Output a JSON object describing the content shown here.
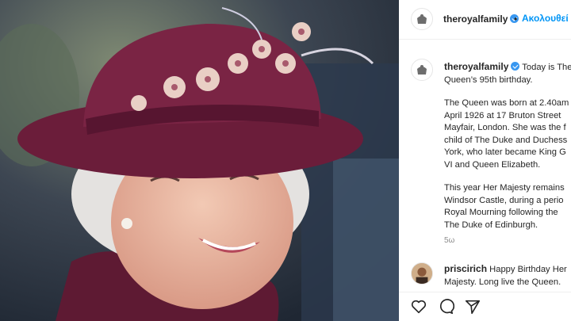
{
  "post": {
    "username": "theroyalfamily",
    "follow_separator": "•",
    "follow_label": "Ακολουθεί",
    "caption_lines": [
      [
        "Today is The",
        "Queen’s 95th birthday."
      ],
      [
        "The Queen was born at 2.40am",
        "April 1926 at 17 Bruton Street",
        "Mayfair, London. She was the f",
        "child of The Duke and Duchess",
        "York, who later became King G",
        "VI and Queen Elizabeth."
      ],
      [
        "This year Her Majesty remains",
        "Windsor Castle, during a perio",
        "Royal Mourning following the",
        "The Duke of Edinburgh."
      ]
    ],
    "time_ago": "5ω"
  },
  "comment": {
    "username": "priscirich",
    "text_line1": "Happy Birthday Her",
    "text_line2": "Majesty. Long live the Queen."
  },
  "icons": [
    "crest-icon",
    "verified-badge-icon",
    "heart-icon",
    "comment-icon",
    "share-icon"
  ],
  "colors": {
    "follow": "#0095f6",
    "verified": "#3897f0",
    "hat": "#6b1d3a"
  }
}
